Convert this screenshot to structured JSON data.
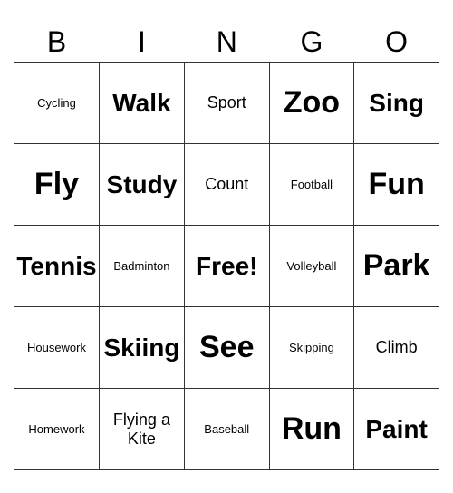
{
  "header": [
    "B",
    "I",
    "N",
    "G",
    "O"
  ],
  "rows": [
    [
      {
        "text": "Cycling",
        "size": "small"
      },
      {
        "text": "Walk",
        "size": "large"
      },
      {
        "text": "Sport",
        "size": "medium"
      },
      {
        "text": "Zoo",
        "size": "xlarge"
      },
      {
        "text": "Sing",
        "size": "large"
      }
    ],
    [
      {
        "text": "Fly",
        "size": "xlarge"
      },
      {
        "text": "Study",
        "size": "large"
      },
      {
        "text": "Count",
        "size": "medium"
      },
      {
        "text": "Football",
        "size": "small"
      },
      {
        "text": "Fun",
        "size": "xlarge"
      }
    ],
    [
      {
        "text": "Tennis",
        "size": "large"
      },
      {
        "text": "Badminton",
        "size": "small"
      },
      {
        "text": "Free!",
        "size": "large"
      },
      {
        "text": "Volleyball",
        "size": "small"
      },
      {
        "text": "Park",
        "size": "xlarge"
      }
    ],
    [
      {
        "text": "Housework",
        "size": "small"
      },
      {
        "text": "Skiing",
        "size": "large"
      },
      {
        "text": "See",
        "size": "xlarge"
      },
      {
        "text": "Skipping",
        "size": "small"
      },
      {
        "text": "Climb",
        "size": "medium"
      }
    ],
    [
      {
        "text": "Homework",
        "size": "small"
      },
      {
        "text": "Flying a Kite",
        "size": "medium"
      },
      {
        "text": "Baseball",
        "size": "small"
      },
      {
        "text": "Run",
        "size": "xlarge"
      },
      {
        "text": "Paint",
        "size": "large"
      }
    ]
  ]
}
